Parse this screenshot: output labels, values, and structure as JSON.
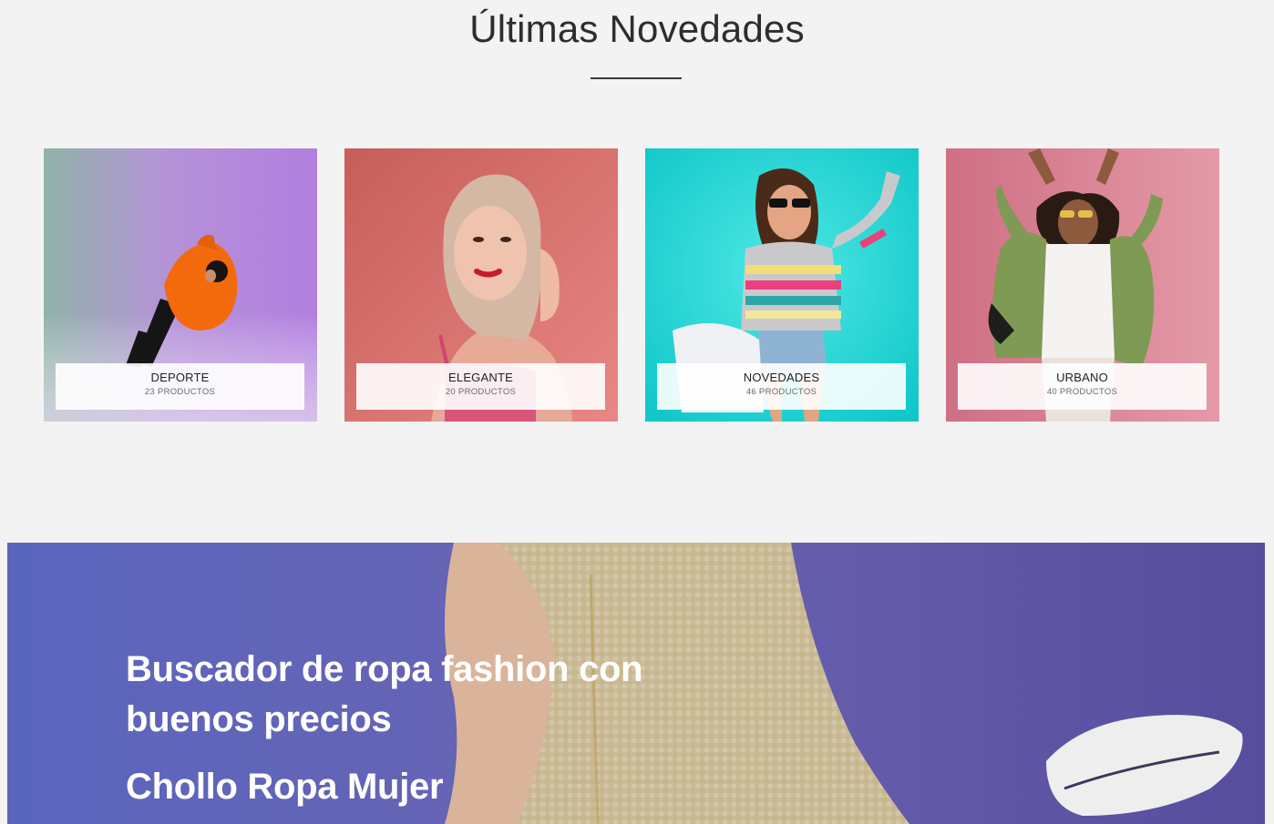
{
  "section": {
    "title": "Últimas Novedades"
  },
  "categories": [
    {
      "title": "DEPORTE",
      "count": "23 PRODUCTOS",
      "icon": "woman-orange-hoodie-photo"
    },
    {
      "title": "ELEGANTE",
      "count": "20 PRODUCTOS",
      "icon": "woman-portrait-photo"
    },
    {
      "title": "NOVEDADES",
      "count": "46 PRODUCTOS",
      "icon": "woman-striped-sweater-photo"
    },
    {
      "title": "URBANO",
      "count": "40 PRODUCTOS",
      "icon": "woman-green-jacket-photo"
    }
  ],
  "banner": {
    "heading": "Buscador de ropa fashion con buenos precios",
    "subheading": "Chollo Ropa Mujer",
    "colors": {
      "overlay": "#5a62b8",
      "dress": "#e8d9a0"
    }
  }
}
